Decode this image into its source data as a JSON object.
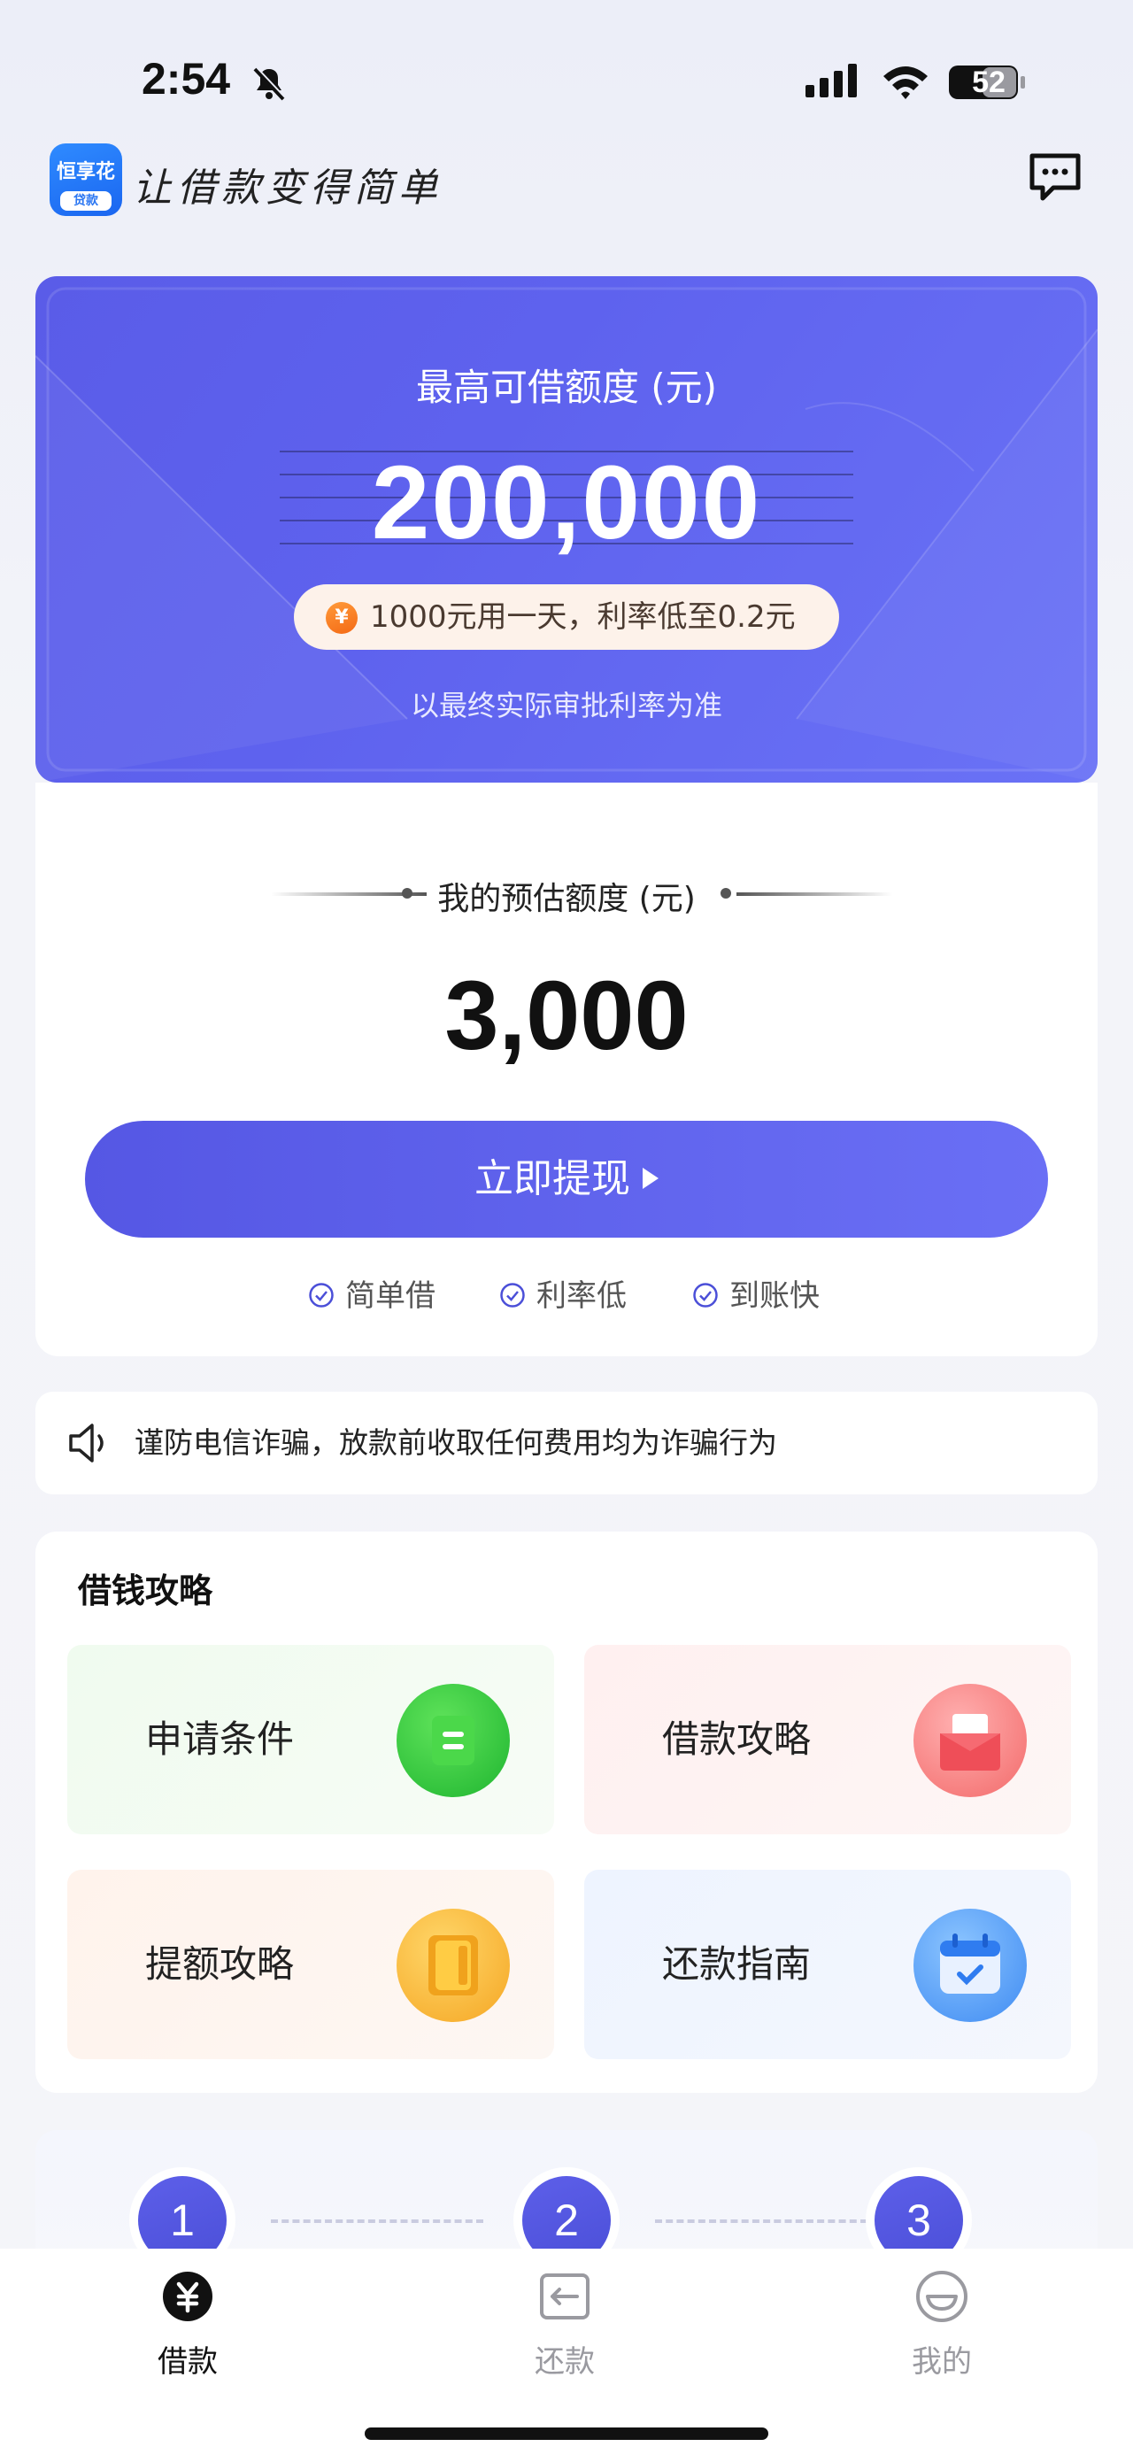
{
  "status_bar": {
    "time": "2:54",
    "battery": "52",
    "icons": [
      "bell-muted-icon",
      "signal-icon",
      "wifi-icon",
      "battery-icon"
    ]
  },
  "header": {
    "logo_name": "恒享花",
    "logo_sub": "贷款",
    "slogan": "让借款变得简单",
    "chat_icon": "chat-icon"
  },
  "hero": {
    "title": "最高可借额度 (元)",
    "amount": "200,000",
    "rate_icon": "¥",
    "rate_text": "1000元用一天，利率低至0.2元",
    "note": "以最终实际审批利率为准"
  },
  "estimate": {
    "title": "我的预估额度 (元)",
    "amount": "3,000",
    "button_label": "立即提现",
    "features": [
      "简单借",
      "利率低",
      "到账快"
    ]
  },
  "notice": {
    "icon": "speaker-icon",
    "text": "谨防电信诈骗，放款前收取任何费用均为诈骗行为"
  },
  "guide": {
    "title": "借钱攻略",
    "tiles": [
      {
        "label": "申请条件",
        "icon": "document-icon"
      },
      {
        "label": "借款攻略",
        "icon": "envelope-icon"
      },
      {
        "label": "提额攻略",
        "icon": "card-icon"
      },
      {
        "label": "还款指南",
        "icon": "calendar-icon"
      }
    ]
  },
  "steps": [
    "1",
    "2",
    "3"
  ],
  "tab_bar": {
    "tabs": [
      {
        "label": "借款",
        "icon": "yuan-icon",
        "active": true
      },
      {
        "label": "还款",
        "icon": "repay-icon",
        "active": false
      },
      {
        "label": "我的",
        "icon": "profile-icon",
        "active": false
      }
    ]
  },
  "colors": {
    "primary": "#5a5ce8",
    "accent_orange": "#f46a15",
    "background": "#f3f4f9"
  }
}
